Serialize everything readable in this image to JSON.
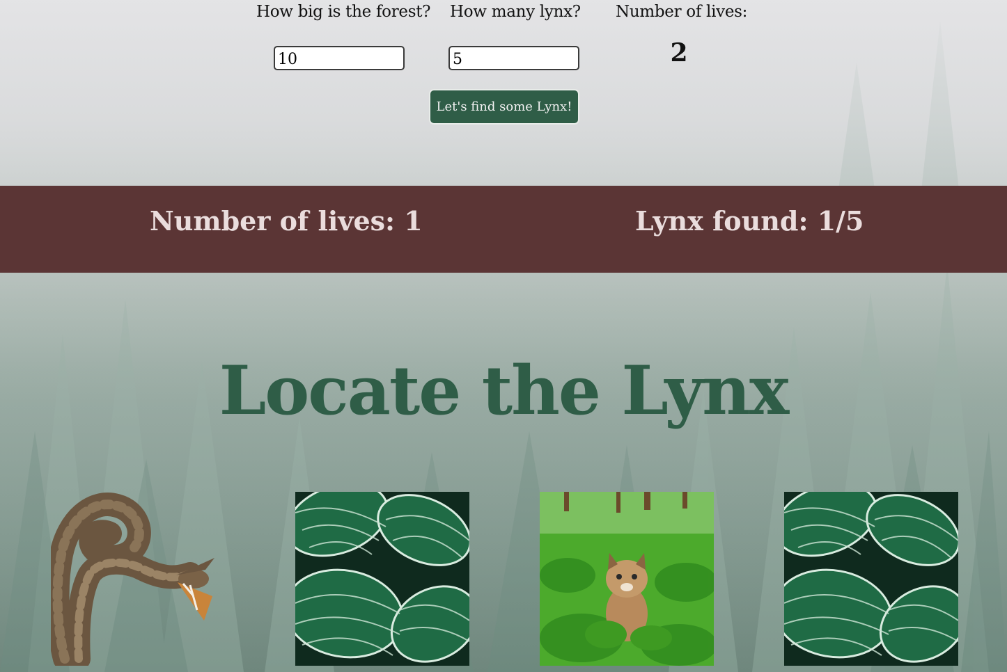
{
  "setup": {
    "forest_size_label": "How big is the forest?",
    "forest_size_value": "10",
    "lynx_count_label": "How many lynx?",
    "lynx_count_value": "5",
    "lives_label": "Number of lives:",
    "lives_value": "2",
    "start_button": "Let's find some Lynx!"
  },
  "status": {
    "lives_text": "Number of lives: 1",
    "found_text": "Lynx found: 1/5"
  },
  "title": "Locate the Lynx",
  "tiles": [
    {
      "kind": "snake-image"
    },
    {
      "kind": "leaves-image"
    },
    {
      "kind": "lynx-image"
    },
    {
      "kind": "leaves-image"
    }
  ],
  "colors": {
    "accent_green": "#2f5d47",
    "status_bar": "#5b3535",
    "status_text": "#eadddd"
  }
}
